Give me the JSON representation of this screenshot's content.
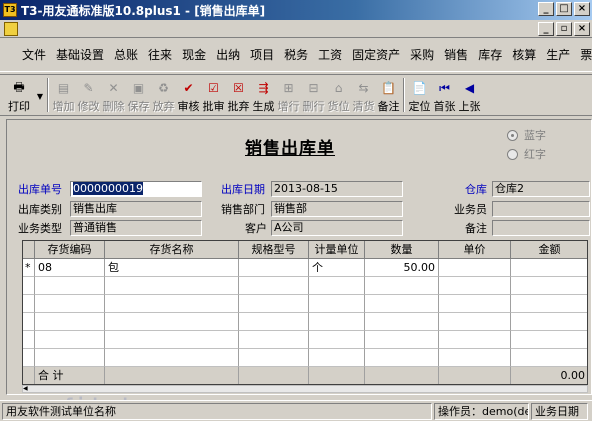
{
  "window": {
    "title": "T3-用友通标准版10.8plus1 - [销售出库单]",
    "controls": [
      "minimize-icon",
      "maximize-icon",
      "close-icon"
    ]
  },
  "menu": [
    "文件",
    "基础设置",
    "总账",
    "往来",
    "现金",
    "出纳",
    "项目",
    "税务",
    "工资",
    "固定资产",
    "采购",
    "销售",
    "库存",
    "核算",
    "生产",
    "票据"
  ],
  "toolbar": {
    "print": "打印",
    "buttons": [
      {
        "label": "增加",
        "icon": "add-doc-icon",
        "enabled": false
      },
      {
        "label": "修改",
        "icon": "edit-doc-icon",
        "enabled": false
      },
      {
        "label": "删除",
        "icon": "delete-icon",
        "enabled": false
      },
      {
        "label": "保存",
        "icon": "save-icon",
        "enabled": false
      },
      {
        "label": "放弃",
        "icon": "discard-icon",
        "enabled": false
      },
      {
        "label": "审核",
        "icon": "approve-icon",
        "enabled": true
      },
      {
        "label": "批审",
        "icon": "batch-approve-icon",
        "enabled": true
      },
      {
        "label": "批弃",
        "icon": "batch-discard-icon",
        "enabled": true
      },
      {
        "label": "生成",
        "icon": "generate-icon",
        "enabled": true
      },
      {
        "label": "增行",
        "icon": "add-row-icon",
        "enabled": false
      },
      {
        "label": "删行",
        "icon": "delete-row-icon",
        "enabled": false
      },
      {
        "label": "货位",
        "icon": "location-icon",
        "enabled": false
      },
      {
        "label": "清货",
        "icon": "clear-goods-icon",
        "enabled": false
      },
      {
        "label": "备注",
        "icon": "note-icon",
        "enabled": true
      },
      {
        "label": "定位",
        "icon": "locate-icon",
        "enabled": true
      },
      {
        "label": "首张",
        "icon": "first-record-icon",
        "enabled": true
      },
      {
        "label": "上张",
        "icon": "prev-record-icon",
        "enabled": true
      }
    ]
  },
  "form": {
    "title": "销售出库单",
    "radio_blue": "蓝字",
    "radio_red": "红字",
    "labels": {
      "order_no": "出库单号",
      "out_date": "出库日期",
      "warehouse": "仓库",
      "out_type": "出库类别",
      "sales_dept": "销售部门",
      "salesperson": "业务员",
      "biz_type": "业务类型",
      "customer": "客户",
      "remark": "备注"
    },
    "values": {
      "order_no": "0000000019",
      "out_date": "2013-08-15",
      "warehouse": "仓库2",
      "out_type": "销售出库",
      "sales_dept": "销售部",
      "salesperson": "",
      "biz_type": "普通销售",
      "customer": "A公司",
      "remark": ""
    }
  },
  "grid": {
    "columns": [
      "存货编码",
      "存货名称",
      "规格型号",
      "计量单位",
      "数量",
      "单价",
      "金额"
    ],
    "rows": [
      {
        "marker": "*",
        "code": "08",
        "name": "包",
        "spec": "",
        "unit": "个",
        "qty": "50.00",
        "price": "",
        "amount": ""
      }
    ],
    "total_label": "合 计",
    "total_amount": "0.00"
  },
  "status": {
    "left": "用友软件测试单位名称",
    "operator": "操作员：demo(demo)",
    "biz_date": "业务日期"
  },
  "watermark": "www.ufidawhy.com"
}
